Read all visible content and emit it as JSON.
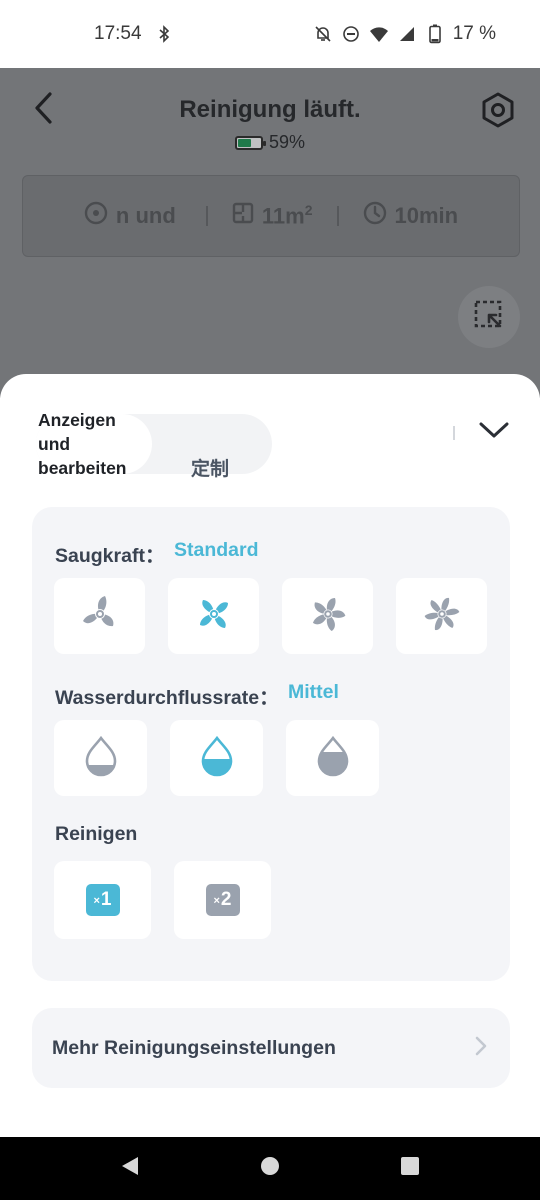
{
  "status_bar": {
    "time": "17:54",
    "battery_percent": "17 %",
    "icons": [
      "bluetooth-icon",
      "notifications-off-icon",
      "do-not-disturb-icon",
      "wifi-icon",
      "signal-icon",
      "battery-icon"
    ]
  },
  "header": {
    "title": "Reinigung läuft.",
    "battery_label": "59%",
    "battery_level": 0.59,
    "back_icon": "back-arrow-icon",
    "settings_icon": "settings-hex-icon"
  },
  "info_card": {
    "mode": "n und \\",
    "area_value": "11m",
    "area_sup": "2",
    "time": "10min"
  },
  "sheet": {
    "segment": {
      "active_label": "Anzeigen und bearbeiten",
      "inactive_label": "定制"
    },
    "suction": {
      "label": "Saugkraft：",
      "value": "Standard",
      "options": [
        "fan-quiet-icon",
        "fan-standard-icon",
        "fan-strong-icon",
        "fan-max-icon"
      ],
      "selected_index": 1
    },
    "water": {
      "label": "Wasserdurchflussrate：",
      "value": "Mittel",
      "options": [
        "water-low-icon",
        "water-medium-icon",
        "water-high-icon"
      ],
      "selected_index": 1
    },
    "clean": {
      "label": "Reinigen",
      "options": [
        {
          "prefix": "×",
          "value": "1"
        },
        {
          "prefix": "×",
          "value": "2"
        }
      ],
      "selected_index": 0
    },
    "more_settings": "Mehr Reinigungseinstellungen"
  },
  "colors": {
    "accent": "#4bb8d6",
    "inactive_icon": "#9aa2ae",
    "panel_bg": "#f4f5f8",
    "overlay_bg": "#737578"
  }
}
